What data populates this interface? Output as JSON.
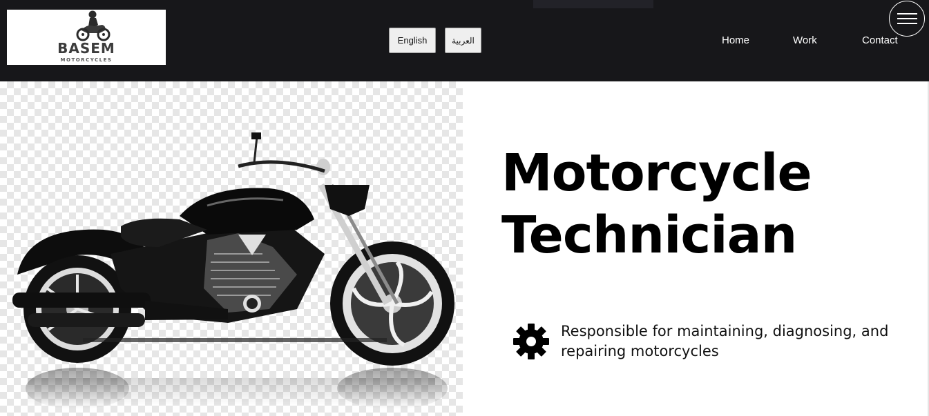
{
  "header": {
    "logo": {
      "title": "BASEM",
      "subtitle": "MOTORCYCLES",
      "rider_icon": "motorcycle-rider-icon"
    },
    "top_strip_text": "",
    "languages": [
      {
        "label": "English"
      },
      {
        "label": "العربية"
      }
    ],
    "nav": [
      {
        "label": "Home"
      },
      {
        "label": "Work"
      },
      {
        "label": "Contact"
      }
    ],
    "menu_icon": "hamburger-menu-icon",
    "colors": {
      "background": "#17171a",
      "nav_text": "#ffffff"
    }
  },
  "hero": {
    "image": "motorcycle-cruiser-photo",
    "title_line_1": "Motorcycle",
    "title_line_2": "Technician",
    "duty": {
      "icon": "gear-icon",
      "text": "Responsible for maintaining, diagnosing, and repairing motorcycles"
    }
  }
}
